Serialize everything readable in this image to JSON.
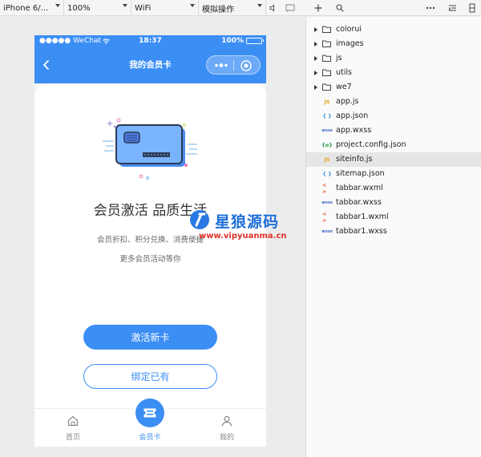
{
  "toolbar": {
    "device": "iPhone 6/...",
    "zoom": "100%",
    "network": "WiFi",
    "action": "模拟操作"
  },
  "phone": {
    "carrier": "●●●●● WeChat",
    "time": "18:37",
    "battery": "100%",
    "nav_title": "我的会员卡"
  },
  "page": {
    "headline": "会员激活 品质生活",
    "desc_line1": "会员折扣、积分兑换、消费便捷",
    "desc_line2": "更多会员活动等你",
    "activate_button": "激活新卡",
    "bind_button": "绑定已有"
  },
  "watermark": {
    "name": "星狼源码",
    "url": "www.vipyuanma.cn"
  },
  "tabbar": {
    "tabs": [
      {
        "label": "首页",
        "icon": "home-icon"
      },
      {
        "label": "会员卡",
        "icon": "ticket-icon",
        "active": true
      },
      {
        "label": "我的",
        "icon": "user-icon"
      }
    ],
    "active_color": "#3b8ef4"
  },
  "file_tree": {
    "items": [
      {
        "name": "colorui",
        "type": "folder"
      },
      {
        "name": "images",
        "type": "folder"
      },
      {
        "name": "js",
        "type": "folder"
      },
      {
        "name": "utils",
        "type": "folder"
      },
      {
        "name": "we7",
        "type": "folder"
      },
      {
        "name": "app.js",
        "type": "js",
        "badge": "JS"
      },
      {
        "name": "app.json",
        "type": "json",
        "badge": "{ }"
      },
      {
        "name": "app.wxss",
        "type": "wxss",
        "badge": "wxss"
      },
      {
        "name": "project.config.json",
        "type": "config",
        "badge": "{o}"
      },
      {
        "name": "siteinfo.js",
        "type": "js",
        "badge": "JS",
        "selected": true
      },
      {
        "name": "sitemap.json",
        "type": "json",
        "badge": "{ }"
      },
      {
        "name": "tabbar.wxml",
        "type": "wxml",
        "badge": "< >"
      },
      {
        "name": "tabbar.wxss",
        "type": "wxss",
        "badge": "wxss"
      },
      {
        "name": "tabbar1.wxml",
        "type": "wxml",
        "badge": "< >"
      },
      {
        "name": "tabbar1.wxss",
        "type": "wxss",
        "badge": "wxss"
      }
    ]
  },
  "colors": {
    "brand_blue": "#3b8ef4",
    "js_badge": "#e8a317",
    "json_badge": "#2d8cf0",
    "wxss_badge": "#3f66c9",
    "config_badge": "#1a9e3f",
    "wxml_badge": "#e8542a"
  }
}
